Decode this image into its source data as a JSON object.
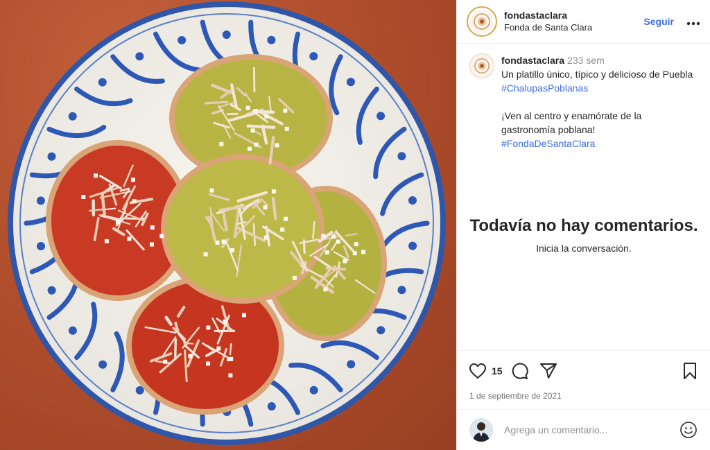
{
  "colors": {
    "link": "#3d6ee0",
    "text": "#262626",
    "muted": "#8e8e8e",
    "divider": "#efefef"
  },
  "header": {
    "username": "fondastaclara",
    "subtitle": "Fonda de Santa Clara",
    "follow_label": "Seguir",
    "more_icon": "more-horizontal-icon"
  },
  "caption": {
    "username": "fondastaclara",
    "time": "233 sem",
    "line1": "Un platillo único, típico y delicioso de Puebla",
    "hashtag1": "#ChalupasPoblanas",
    "line2": "¡Ven al centro y enamórate de la gastronomía poblana!",
    "hashtag2": "#FondaDeSantaClara"
  },
  "empty_state": {
    "title": "Todavía no hay comentarios.",
    "subtitle": "Inicia la conversación."
  },
  "actions": {
    "like_icon": "heart-icon",
    "likes_count": "15",
    "comment_icon": "comment-icon",
    "share_icon": "send-icon",
    "save_icon": "bookmark-icon",
    "date": "1 de septiembre de 2021"
  },
  "comment_bar": {
    "placeholder": "Agrega un comentario...",
    "emoji_icon": "emoji-icon"
  }
}
